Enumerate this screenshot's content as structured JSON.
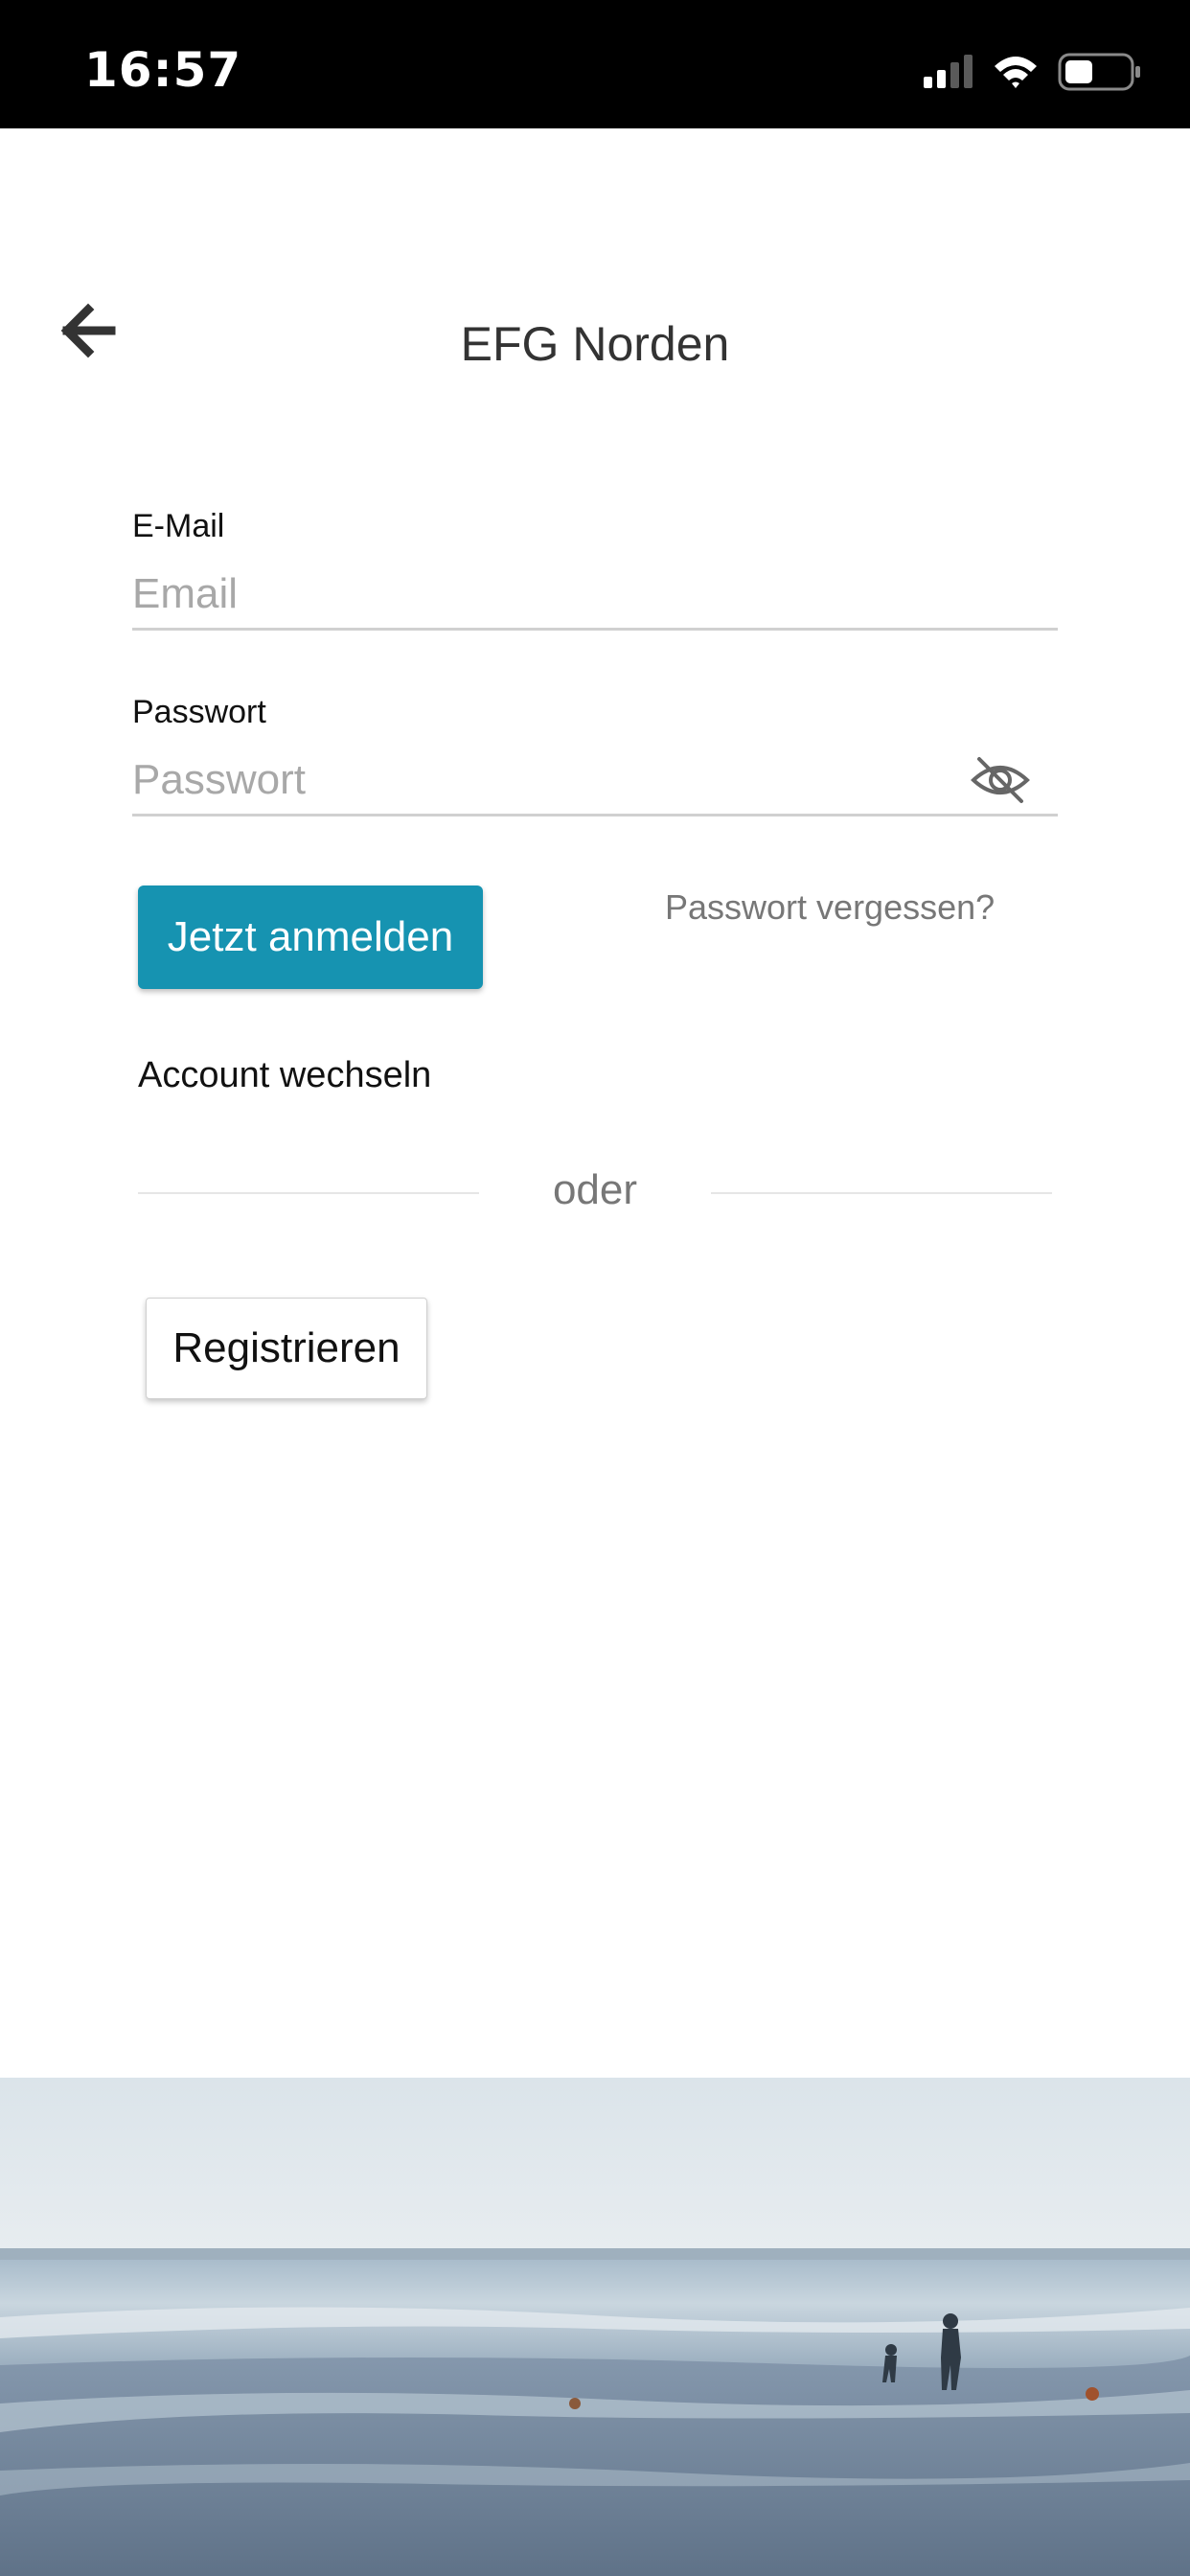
{
  "status_bar": {
    "time": "16:57"
  },
  "header": {
    "title": "EFG Norden",
    "back_icon": "arrow-left-icon"
  },
  "login_form": {
    "email_label": "E-Mail",
    "email_placeholder": "Email",
    "email_value": "",
    "password_label": "Passwort",
    "password_placeholder": "Passwort",
    "password_value": "",
    "visibility_icon": "eye-slash-icon",
    "login_button": "Jetzt anmelden",
    "forgot_password": "Passwort vergessen?",
    "switch_account": "Account wechseln",
    "divider_text": "oder",
    "register_button": "Registrieren"
  },
  "colors": {
    "primary": "#1693b1",
    "status_bar_background": "#000000"
  }
}
